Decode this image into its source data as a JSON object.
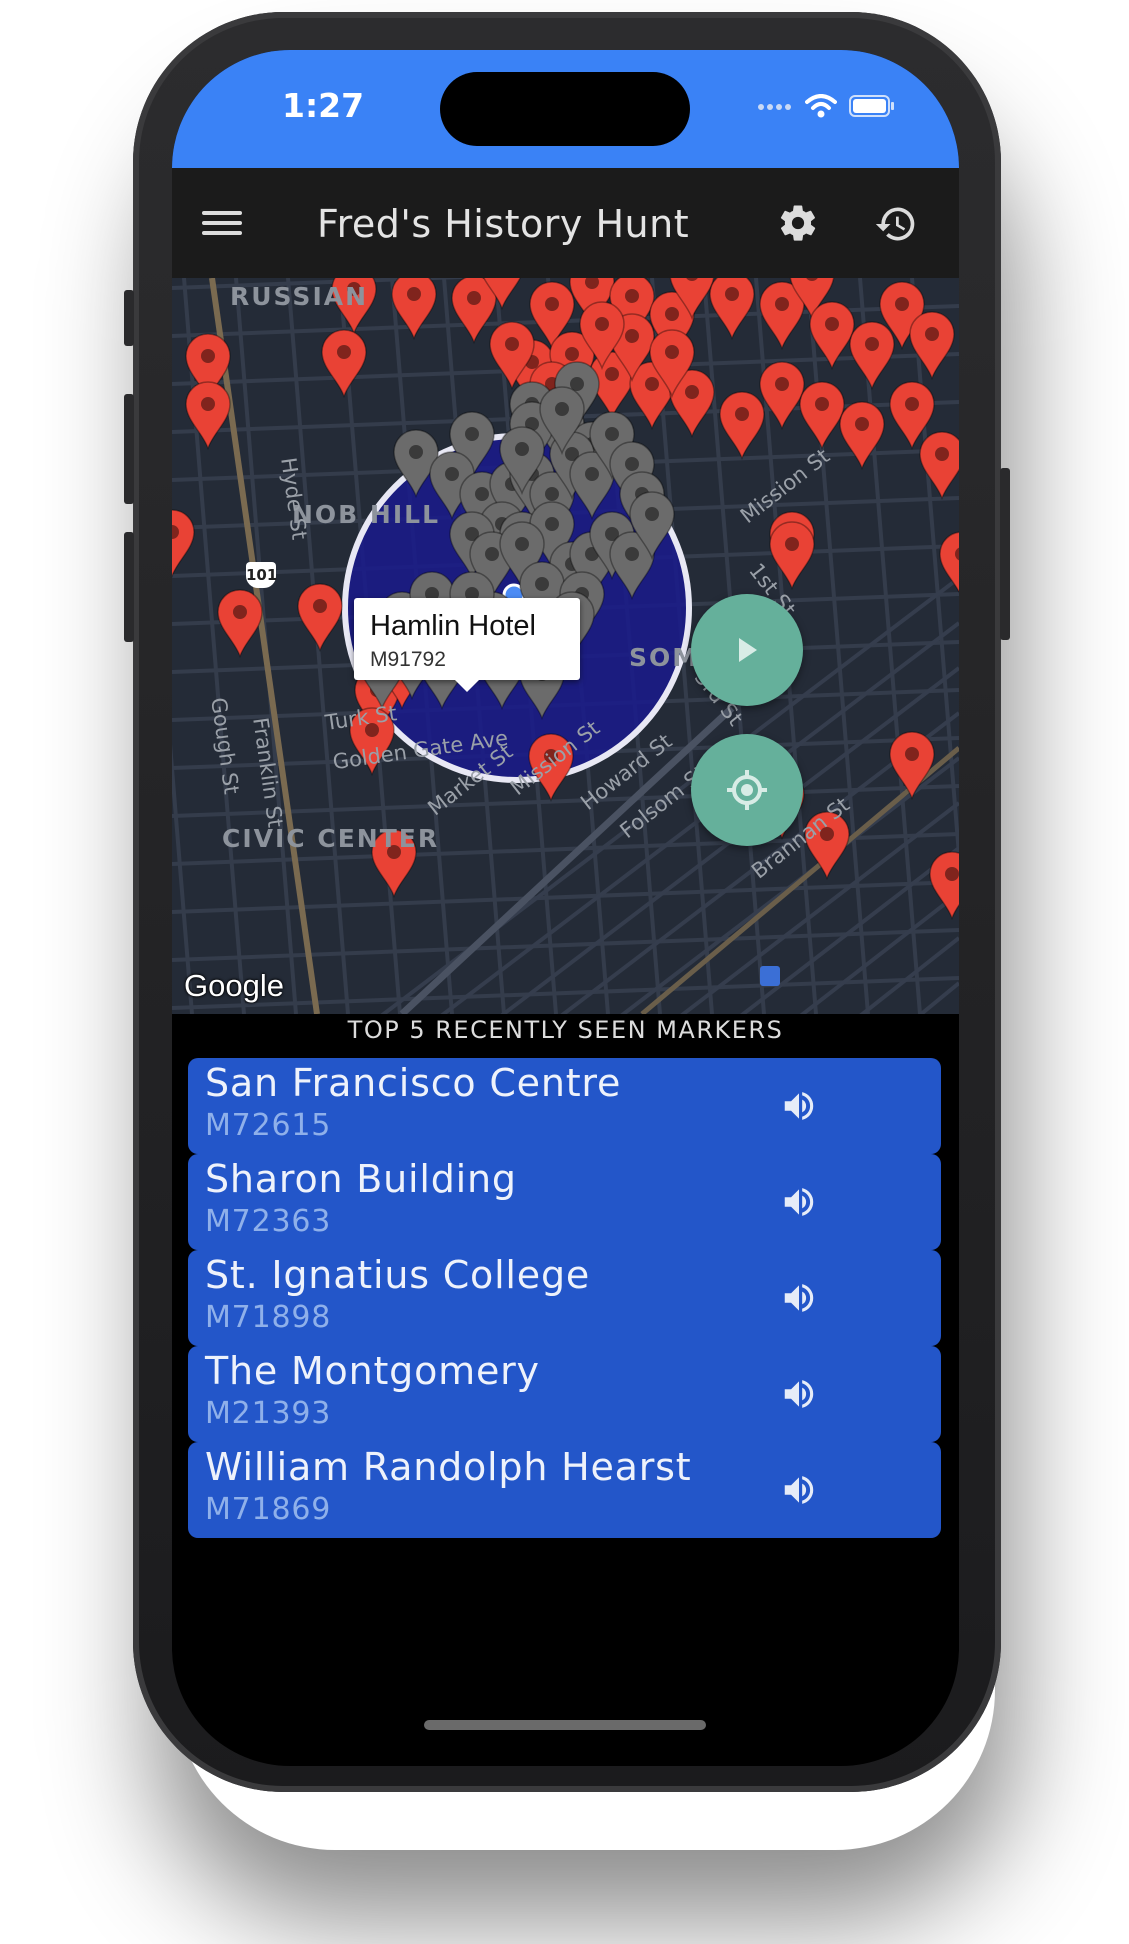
{
  "status_bar": {
    "time": "1:27",
    "background_color": "#3a82f6"
  },
  "appbar": {
    "title": "Fred's History Hunt",
    "menu_icon": "hamburger-menu-icon",
    "settings_icon": "gear-icon",
    "history_icon": "history-icon"
  },
  "map": {
    "street_labels": [
      "Hyde St",
      "Gough St",
      "Franklin St",
      "Turk St",
      "Golden Gate Ave",
      "Market St",
      "Mission St",
      "Howard St",
      "Folsom St",
      "3rd St",
      "1st St",
      "Mission St",
      "Brannan St"
    ],
    "area_labels": [
      "RUSSIAN",
      "NOB HILL",
      "CIVIC CENTER",
      "SOMA"
    ],
    "highway_shield": "101",
    "info_window": {
      "title": "Hamlin Hotel",
      "subtitle": "M91792"
    },
    "attribution": "Google",
    "play_button_icon": "play-icon",
    "locate_button_icon": "my-location-icon",
    "colors": {
      "unvisited_marker": "#e94235",
      "visited_marker": "#6b6b6b",
      "radius_fill": "#1a1a8c",
      "fab": "#65b09b"
    }
  },
  "recent": {
    "heading": "TOP 5 RECENTLY SEEN MARKERS",
    "items": [
      {
        "name": "San Francisco Centre",
        "id": "M72615"
      },
      {
        "name": "Sharon Building",
        "id": "M72363"
      },
      {
        "name": "St. Ignatius College",
        "id": "M71898"
      },
      {
        "name": "The Montgomery",
        "id": "M21393"
      },
      {
        "name": "William Randolph Hearst",
        "id": "M71869"
      }
    ],
    "speaker_icon": "speaker-icon",
    "card_color": "#2356c9"
  }
}
